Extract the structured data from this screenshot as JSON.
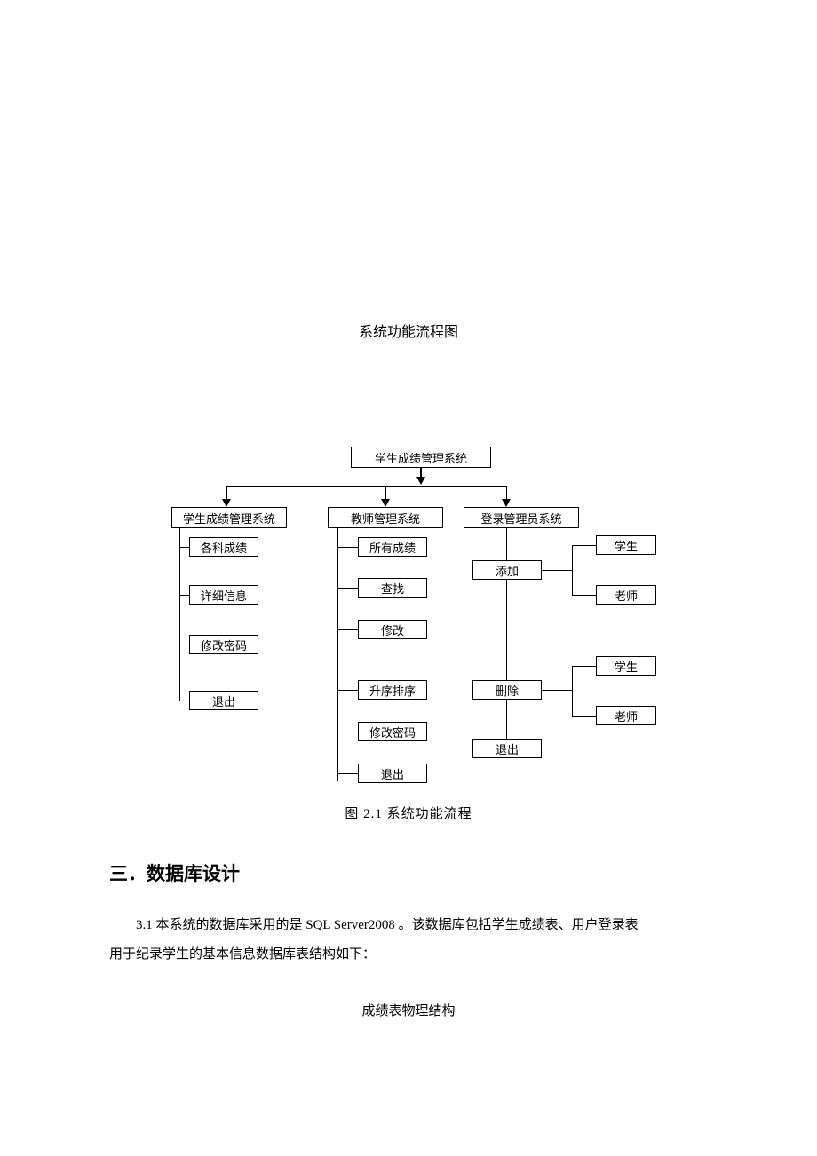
{
  "pageTitle": "系统功能流程图",
  "diagram": {
    "root": "学生成绩管理系统",
    "col1": {
      "header": "学生成绩管理系统",
      "items": [
        "各科成绩",
        "详细信息",
        "修改密码",
        "退出"
      ]
    },
    "col2": {
      "header": "教师管理系统",
      "items": [
        "所有成绩",
        "查找",
        "修改",
        "升序排序",
        "修改密码",
        "退出"
      ]
    },
    "col3": {
      "header": "登录管理员系统",
      "mid": [
        "添加",
        "删除",
        "退出"
      ],
      "sub1": [
        "学生",
        "老师"
      ],
      "sub2": [
        "学生",
        "老师"
      ]
    }
  },
  "caption": "图 2.1   系统功能流程",
  "sectionHeading": "三．数据库设计",
  "body": {
    "p1": "3.1 本系统的数据库采用的是 SQL Server2008 。该数据库包括学生成绩表、用户登录表",
    "p2": "用于纪录学生的基本信息数据库表结构如下："
  },
  "tableTitle": "成绩表物理结构"
}
